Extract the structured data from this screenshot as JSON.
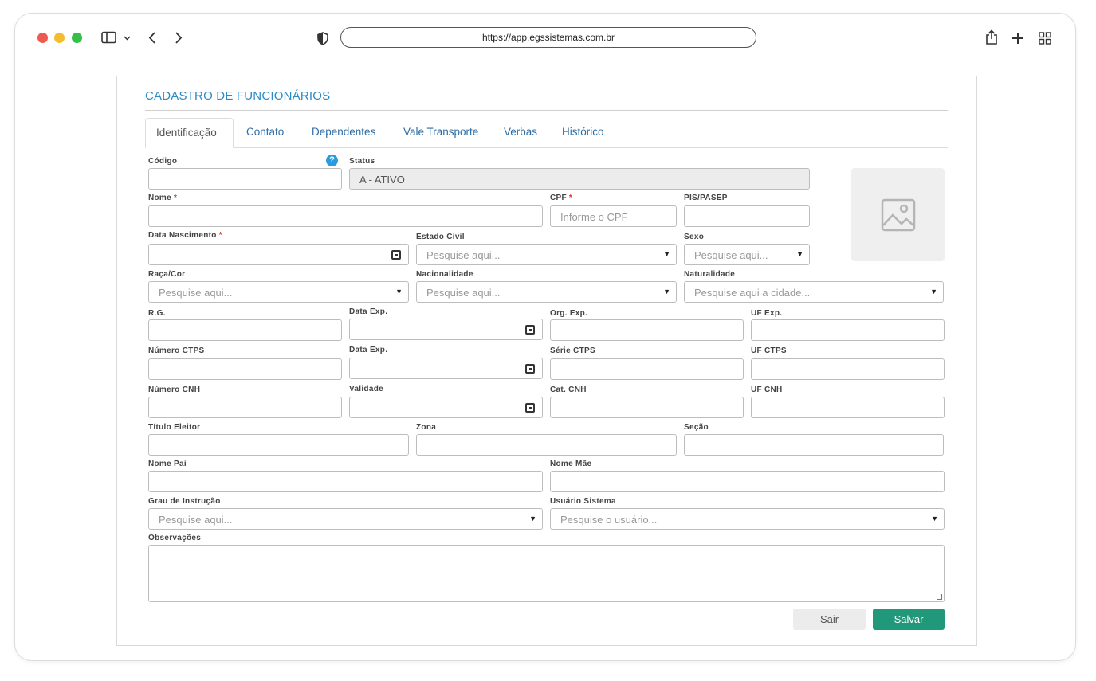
{
  "browser": {
    "url": "https://app.egssistemas.com.br",
    "dots": [
      "#ee5a52",
      "#f5bd2e",
      "#32c146"
    ]
  },
  "page": {
    "title": "CADASTRO DE FUNCIONÁRIOS",
    "tabs": [
      "Identificação",
      "Contato",
      "Dependentes",
      "Vale Transporte",
      "Verbas",
      "Histórico"
    ]
  },
  "form": {
    "codigo_label": "Código",
    "status_label": "Status",
    "status_value": "A - ATIVO",
    "nome_label": "Nome",
    "required_mark": "*",
    "cpf_label": "CPF",
    "cpf_placeholder": "Informe o CPF",
    "pis_label": "PIS/PASEP",
    "nascimento_label": "Data Nascimento",
    "estado_civil_label": "Estado Civil",
    "sexo_label": "Sexo",
    "raca_label": "Raça/Cor",
    "nacionalidade_label": "Nacionalidade",
    "naturalidade_label": "Naturalidade",
    "search_placeholder": "Pesquise aqui...",
    "cidade_placeholder": "Pesquise aqui a cidade...",
    "rg_label": "R.G.",
    "data_exp_label": "Data Exp.",
    "org_exp_label": "Org. Exp.",
    "uf_exp_label": "UF Exp.",
    "ctps_label": "Número CTPS",
    "serie_ctps_label": "Série CTPS",
    "uf_ctps_label": "UF CTPS",
    "cnh_label": "Número CNH",
    "validade_label": "Validade",
    "cat_cnh_label": "Cat. CNH",
    "uf_cnh_label": "UF CNH",
    "titulo_label": "Título Eleitor",
    "zona_label": "Zona",
    "secao_label": "Seção",
    "pai_label": "Nome Pai",
    "mae_label": "Nome Mãe",
    "instrucao_label": "Grau de Instrução",
    "usuario_label": "Usuário Sistema",
    "usuario_placeholder": "Pesquise o usuário...",
    "observacoes_label": "Observações",
    "help_glyph": "?"
  },
  "actions": {
    "sair": "Sair",
    "salvar": "Salvar"
  },
  "icons": {
    "help": "question-circle-icon",
    "calendar": "calendar-icon",
    "photo": "image-placeholder-icon"
  },
  "colors": {
    "accent": "#2c8ac6",
    "save": "#21987a",
    "required": "#d33333"
  }
}
